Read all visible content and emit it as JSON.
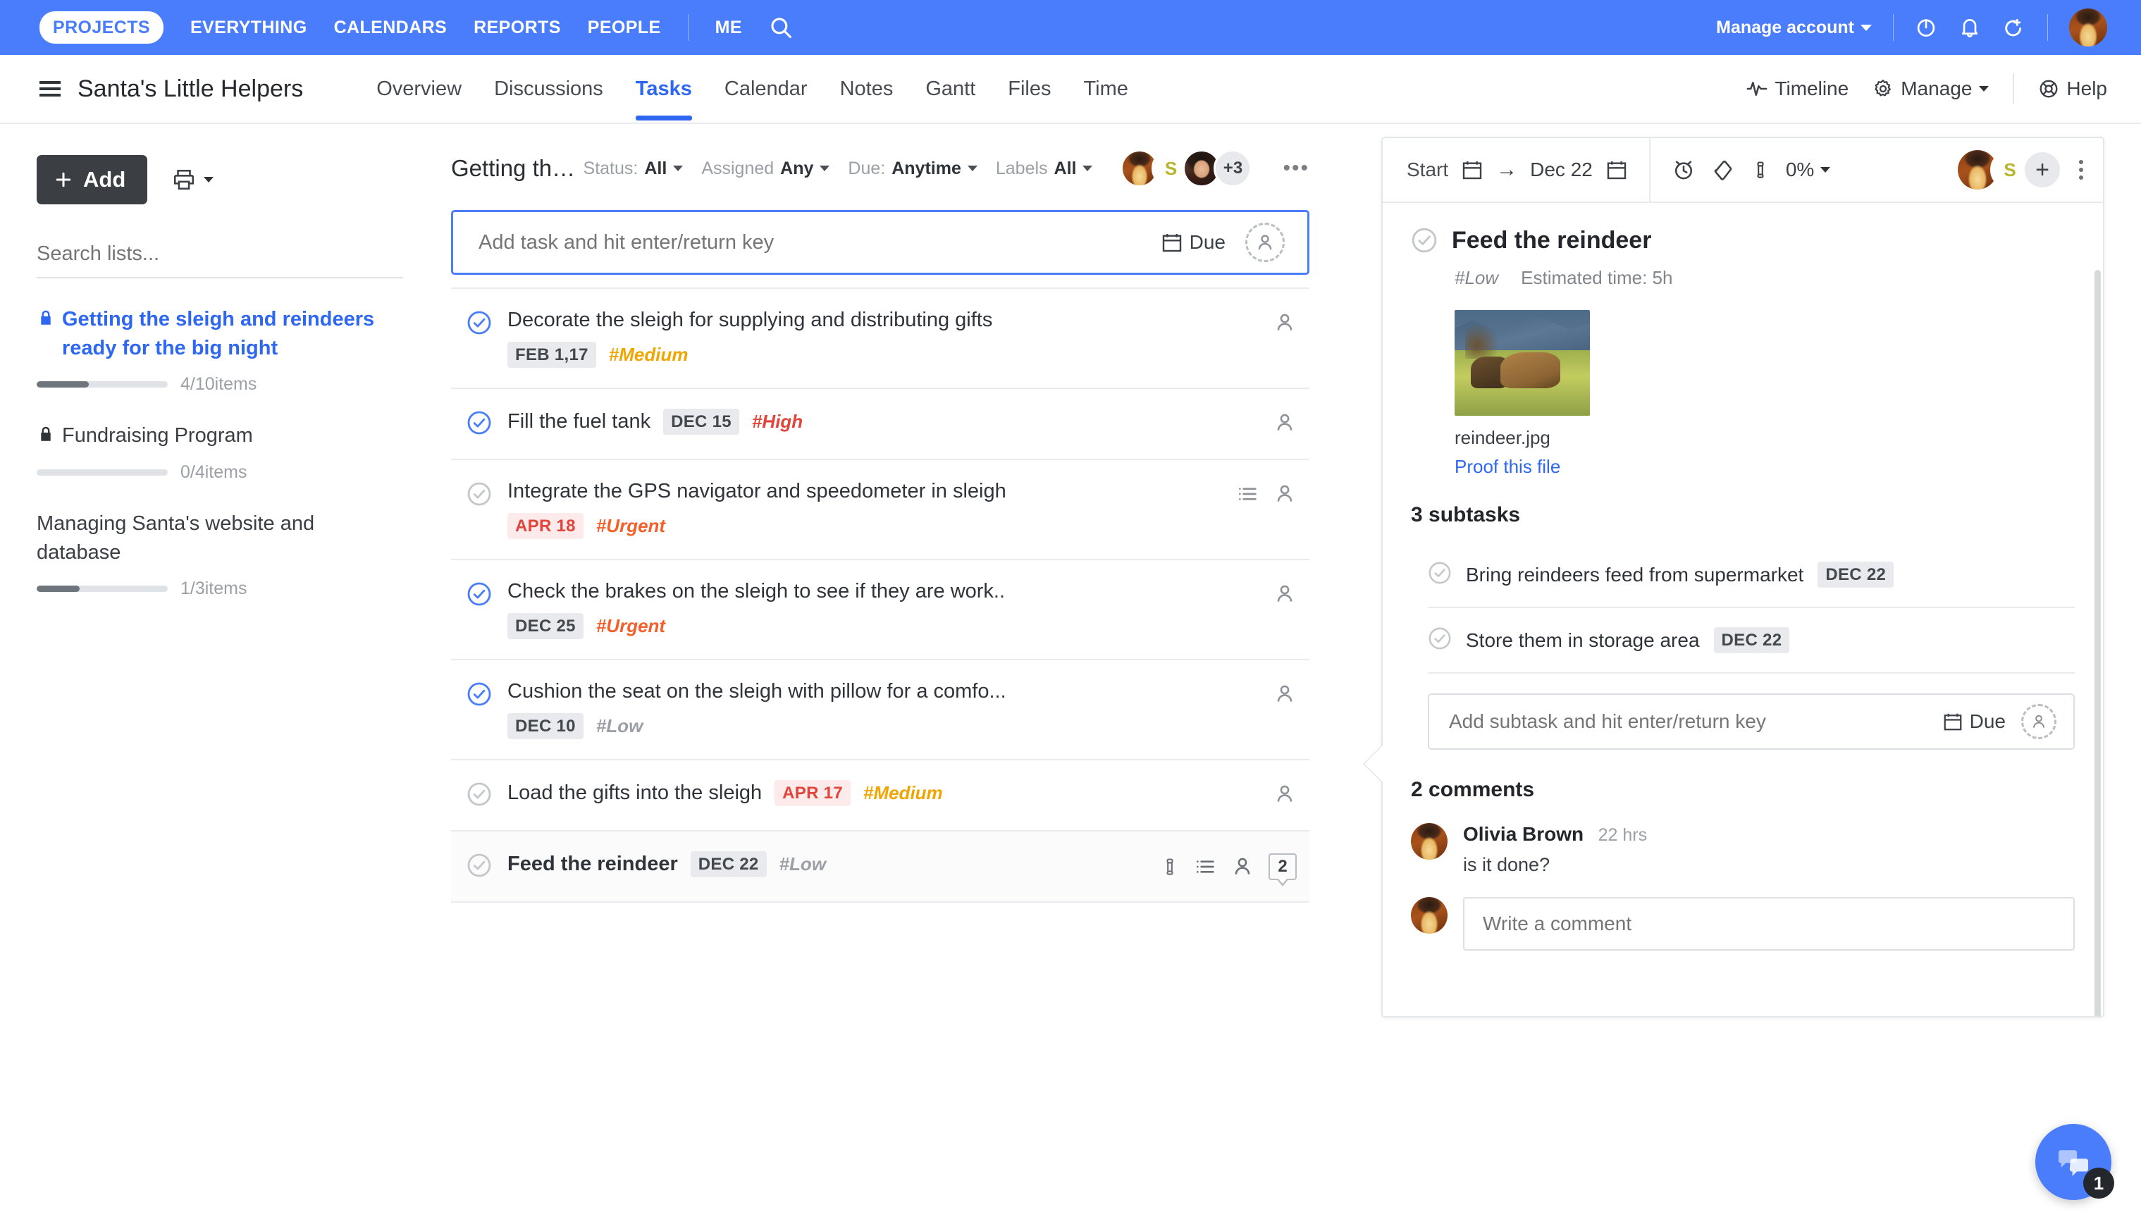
{
  "topnav": {
    "brand_pill": "PROJECTS",
    "items": [
      "EVERYTHING",
      "CALENDARS",
      "REPORTS",
      "PEOPLE"
    ],
    "me_label": "ME",
    "search_icon": "search-icon",
    "manage_account": "Manage account",
    "icons": [
      "power-icon",
      "bell-icon",
      "logout-icon"
    ],
    "brand_color": "#4a7dfc"
  },
  "project_header": {
    "title": "Santa's Little Helpers",
    "tabs": [
      {
        "label": "Overview",
        "active": false
      },
      {
        "label": "Discussions",
        "active": false
      },
      {
        "label": "Tasks",
        "active": true
      },
      {
        "label": "Calendar",
        "active": false
      },
      {
        "label": "Notes",
        "active": false
      },
      {
        "label": "Gantt",
        "active": false
      },
      {
        "label": "Files",
        "active": false
      },
      {
        "label": "Time",
        "active": false
      }
    ],
    "timeline": "Timeline",
    "manage": "Manage",
    "help": "Help"
  },
  "sidebar": {
    "add_label": "Add",
    "search_placeholder": "Search lists...",
    "lists": [
      {
        "name": "Getting the sleigh and reindeers ready for the big night",
        "locked": true,
        "active": true,
        "progress_label": "4/10items",
        "progress_pct": 40
      },
      {
        "name": "Fundraising Program",
        "locked": true,
        "active": false,
        "progress_label": "0/4items",
        "progress_pct": 0
      },
      {
        "name": "Managing Santa's website and database",
        "locked": false,
        "active": false,
        "progress_label": "1/3items",
        "progress_pct": 33
      }
    ]
  },
  "tasklist": {
    "title": "Getting the sleigh and reindeers ready for the big...",
    "filters": [
      {
        "key": "Status:",
        "value": "All"
      },
      {
        "key": "Assigned",
        "value": "Any"
      },
      {
        "key": "Due:",
        "value": "Anytime"
      },
      {
        "key": "Labels",
        "value": "All"
      }
    ],
    "avatar_overflow": "+3",
    "avatar_s": "S",
    "more_dots": "•••",
    "add_placeholder": "Add task and hit enter/return key",
    "due_label": "Due",
    "tasks": [
      {
        "title": "Decorate the sleigh for supplying and distributing gifts",
        "date": "FEB 1,17",
        "overdue": false,
        "label": "#Medium",
        "label_class": "l-medium",
        "done": true,
        "wrap": true,
        "icons": [
          "person-icon"
        ],
        "selected": false
      },
      {
        "title": "Fill the fuel tank",
        "date": "DEC 15",
        "overdue": false,
        "label": "#High",
        "label_class": "l-high",
        "done": true,
        "wrap": false,
        "icons": [
          "person-icon"
        ],
        "selected": false
      },
      {
        "title": "Integrate the GPS navigator and speedometer in sleigh",
        "date": "APR 18",
        "overdue": true,
        "label": "#Urgent",
        "label_class": "l-urgent",
        "done": false,
        "wrap": true,
        "icons": [
          "subtask-icon",
          "person-icon"
        ],
        "selected": false
      },
      {
        "title": "Check the brakes on the sleigh to see if they are work..",
        "date": "DEC 25",
        "overdue": false,
        "label": "#Urgent",
        "label_class": "l-urgent",
        "done": true,
        "wrap": true,
        "icons": [
          "person-icon"
        ],
        "selected": false
      },
      {
        "title": "Cushion the seat on the sleigh with pillow for a comfo...",
        "date": "DEC 10",
        "overdue": false,
        "label": "#Low",
        "label_class": "l-low",
        "done": true,
        "wrap": true,
        "icons": [
          "person-icon"
        ],
        "selected": false
      },
      {
        "title": "Load the gifts into the sleigh",
        "date": "APR 17",
        "overdue": true,
        "label": "#Medium",
        "label_class": "l-medium",
        "done": false,
        "wrap": false,
        "icons": [
          "person-icon"
        ],
        "selected": false
      },
      {
        "title": "Feed the reindeer",
        "date": "DEC 22",
        "overdue": false,
        "label": "#Low",
        "label_class": "l-low",
        "done": false,
        "wrap": false,
        "icons": [
          "attachment-icon",
          "subtask-icon",
          "person-icon"
        ],
        "comment_count": "2",
        "selected": true
      }
    ]
  },
  "detail": {
    "start_label": "Start",
    "due_date": "Dec 22",
    "progress_pct": "0%",
    "avatar_s": "S",
    "title": "Feed the reindeer",
    "label": "#Low",
    "estimated": "Estimated time: 5h",
    "file_name": "reindeer.jpg",
    "proof_link": "Proof this file",
    "subtasks_title": "3 subtasks",
    "subtasks": [
      {
        "title": "Bring reindeers feed from supermarket",
        "date": "DEC 22",
        "done": false
      },
      {
        "title": "Store them in storage area",
        "date": "DEC 22",
        "done": false
      }
    ],
    "add_subtask_placeholder": "Add subtask and hit enter/return key",
    "due_label": "Due",
    "comments_title": "2 comments",
    "comments": [
      {
        "author": "Olivia Brown",
        "time": "22 hrs",
        "text": "is it done?"
      }
    ],
    "comment_placeholder": "Write a comment"
  },
  "chat": {
    "badge": "1",
    "icon": "chat-bubbles-icon"
  }
}
